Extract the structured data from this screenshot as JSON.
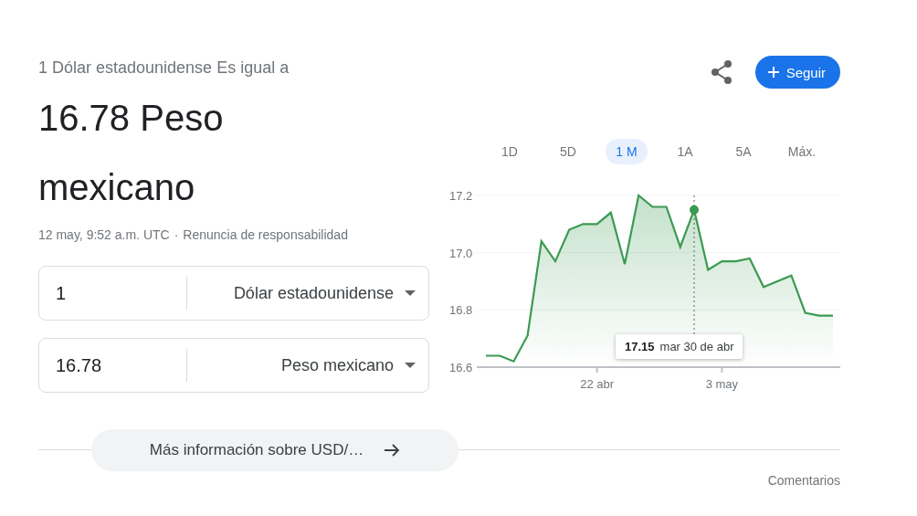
{
  "header": {
    "label": "1 Dólar estadounidense Es igual a",
    "result": "16.78 Peso mexicano",
    "timestamp": "12 may, 9:52 a.m. UTC",
    "separator": "·",
    "disclaimer": "Renuncia de responsabilidad"
  },
  "actions": {
    "follow": "Seguir"
  },
  "converter": [
    {
      "amount": "1",
      "currency": "Dólar estadounidense"
    },
    {
      "amount": "16.78",
      "currency": "Peso mexicano"
    }
  ],
  "ranges": [
    {
      "label": "1D",
      "selected": false
    },
    {
      "label": "5D",
      "selected": false
    },
    {
      "label": "1 M",
      "selected": true
    },
    {
      "label": "1A",
      "selected": false
    },
    {
      "label": "5A",
      "selected": false
    },
    {
      "label": "Máx.",
      "selected": false
    }
  ],
  "chart": {
    "tooltip": {
      "value": "17.15",
      "date": "mar 30 de abr"
    },
    "chart_data": {
      "type": "area",
      "categories": [
        null,
        null,
        null,
        null,
        null,
        null,
        null,
        null,
        "22 abr",
        null,
        null,
        null,
        null,
        null,
        null,
        null,
        null,
        "3 may",
        null,
        null,
        null,
        null,
        null,
        null,
        null,
        null
      ],
      "series": [
        {
          "color": "#3b9a52",
          "values": [
            16.64,
            16.64,
            16.62,
            16.71,
            17.04,
            16.97,
            17.08,
            17.1,
            17.1,
            17.14,
            16.96,
            17.2,
            17.16,
            17.16,
            17.02,
            17.15,
            16.94,
            16.97,
            16.97,
            16.98,
            16.88,
            16.9,
            16.92,
            16.79,
            16.78,
            16.78
          ]
        }
      ],
      "ylim": [
        16.6,
        17.2
      ],
      "yticks": [
        16.6,
        16.8,
        {
          "value": 17,
          "label": "17.0"
        },
        17.2
      ]
    }
  },
  "more": "Más información sobre USD/…",
  "feedback": "Comentarios"
}
